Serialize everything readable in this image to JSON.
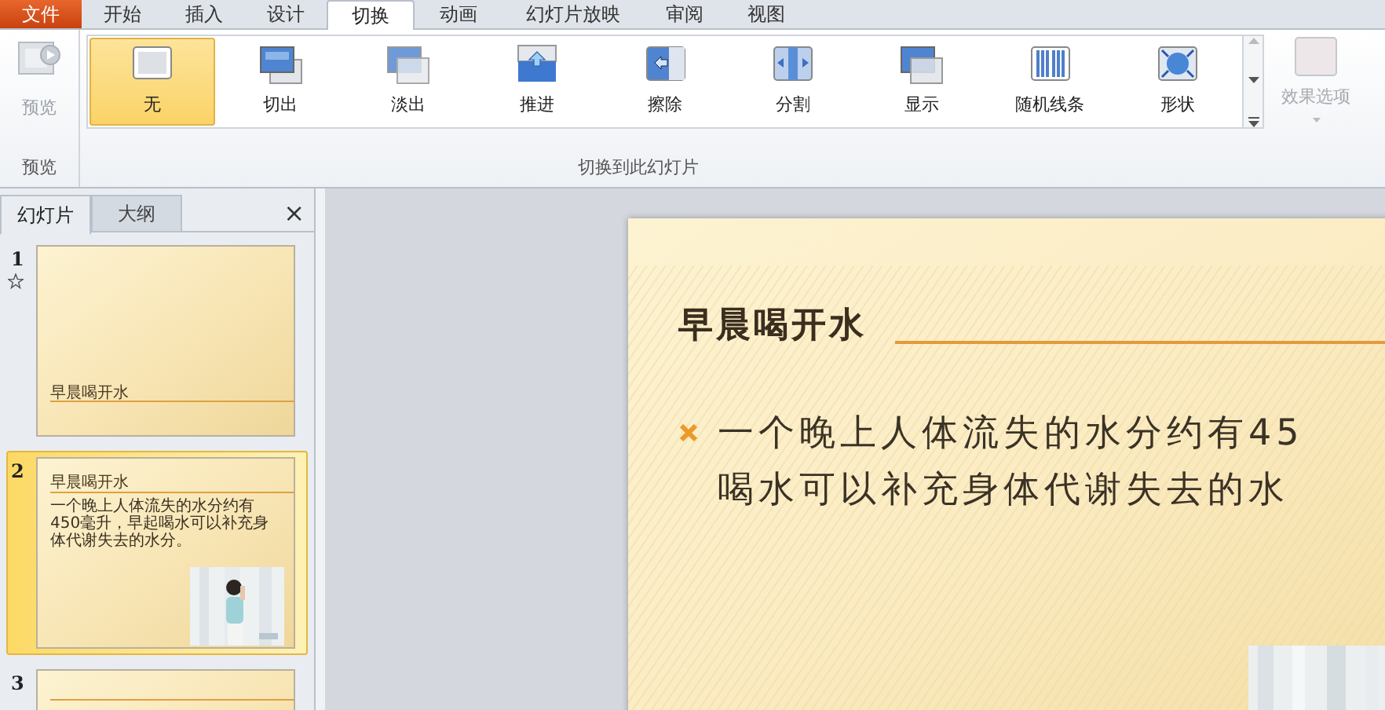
{
  "ribbon_tabs": [
    {
      "label": "文件",
      "kind": "file",
      "selected": false
    },
    {
      "label": "开始",
      "kind": "tab",
      "selected": false
    },
    {
      "label": "插入",
      "kind": "tab",
      "selected": false
    },
    {
      "label": "设计",
      "kind": "tab",
      "selected": false
    },
    {
      "label": "切换",
      "kind": "tab",
      "selected": true
    },
    {
      "label": "动画",
      "kind": "tab",
      "selected": false
    },
    {
      "label": "幻灯片放映",
      "kind": "tab",
      "selected": false
    },
    {
      "label": "审阅",
      "kind": "tab",
      "selected": false
    },
    {
      "label": "视图",
      "kind": "tab",
      "selected": false
    }
  ],
  "preview_group": {
    "button": {
      "label": "预览",
      "disabled": true
    },
    "label": "预览"
  },
  "transition_group": {
    "label": "切换到此幻灯片",
    "effect_options": {
      "label": "效果选项",
      "disabled": true
    },
    "transitions": [
      {
        "label": "无",
        "selected": true
      },
      {
        "label": "切出",
        "selected": false
      },
      {
        "label": "淡出",
        "selected": false
      },
      {
        "label": "推进",
        "selected": false
      },
      {
        "label": "擦除",
        "selected": false
      },
      {
        "label": "分割",
        "selected": false
      },
      {
        "label": "显示",
        "selected": false
      },
      {
        "label": "随机线条",
        "selected": false
      },
      {
        "label": "形状",
        "selected": false
      }
    ]
  },
  "pane_tabs": [
    {
      "label": "幻灯片",
      "selected": true
    },
    {
      "label": "大纲",
      "selected": false
    }
  ],
  "pane_close": "×",
  "thumbnails": [
    {
      "number": "1",
      "has_transition": true,
      "selected": false,
      "title": "早晨喝开水",
      "kind": "title"
    },
    {
      "number": "2",
      "has_transition": false,
      "selected": true,
      "title": "早晨喝开水",
      "body": "一个晚上人体流失的水分约有450毫升，早起喝水可以补充身体代谢失去的水分。",
      "kind": "content"
    },
    {
      "number": "3",
      "has_transition": false,
      "selected": false,
      "kind": "blank"
    }
  ],
  "slide": {
    "title": "早晨喝开水",
    "bullet_lines": [
      "一个晚上人体流失的水分约有45",
      "喝水可以补充身体代谢失去的水"
    ]
  }
}
